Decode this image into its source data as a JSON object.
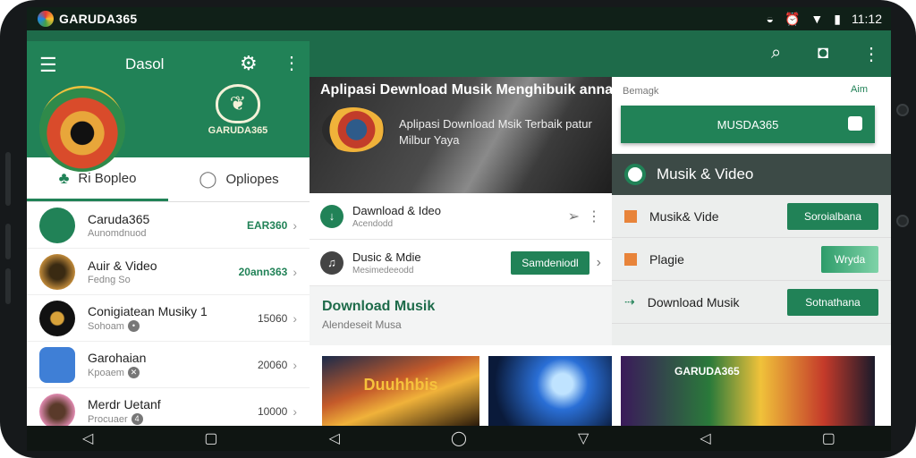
{
  "status_bar": {
    "app_name": "GARUDA365",
    "time": "11:12",
    "icons": [
      "wifi-icon",
      "alarm-icon",
      "signal-icon",
      "battery-icon"
    ]
  },
  "app_bar": {
    "icons": [
      "search-icon",
      "share-icon",
      "more-vert-icon"
    ]
  },
  "left_panel": {
    "title": "Dasol",
    "logo_text": "GARUDA365",
    "tabs": [
      {
        "label": "Ri Bopleo",
        "icon": "clover-icon"
      },
      {
        "label": "Opliopes",
        "icon": "chat-icon"
      }
    ],
    "items": [
      {
        "title": "Caruda365",
        "subtitle": "Aunomdnuod",
        "count": "EAR360",
        "green": true
      },
      {
        "title": "Auir & Video",
        "subtitle": "Fedng So",
        "count": "20ann363",
        "green": true
      },
      {
        "title": "Conigiatean Musiky 1",
        "subtitle": "Sohoam",
        "count": "15060",
        "green": false
      },
      {
        "title": "Garohaian",
        "subtitle": "Kpoaem",
        "count": "20060",
        "green": false
      },
      {
        "title": "Merdr Uetanf",
        "subtitle": "Procuaer",
        "count": "10000",
        "green": false
      }
    ]
  },
  "middle_panel": {
    "hero_title": "Aplipasi Dewnload Musik Menghibuik anna",
    "hero_subtitle": "Aplipasi Download Msik Terbaik patur Milbur Yaya",
    "rows": [
      {
        "title": "Dawnload & Ideo",
        "subtitle": "Acendodd"
      },
      {
        "title": "Dusic & Mdie",
        "subtitle": "Mesimedeeodd",
        "button": "Samdeniodl"
      }
    ],
    "download_title": "Download Musik",
    "download_subtitle": "Alendeseit Musa"
  },
  "right_panel": {
    "top_left_label": "Bemagk",
    "top_right_label": "Aim",
    "big_button": "MUSDA365",
    "band_title": "Musik & Video",
    "rows": [
      {
        "label": "Musik& Vide",
        "button": "Soroialbana"
      },
      {
        "label": "Plagie",
        "button": "Wryda"
      },
      {
        "label": "Download Musik",
        "button": "Sotnathana"
      }
    ]
  },
  "photos": [
    {
      "caption": "Duuhhbis"
    },
    {
      "caption": ""
    },
    {
      "caption": "GARUDA365"
    }
  ],
  "colors": {
    "accent": "#218257",
    "appbar": "#1e6b4a"
  }
}
